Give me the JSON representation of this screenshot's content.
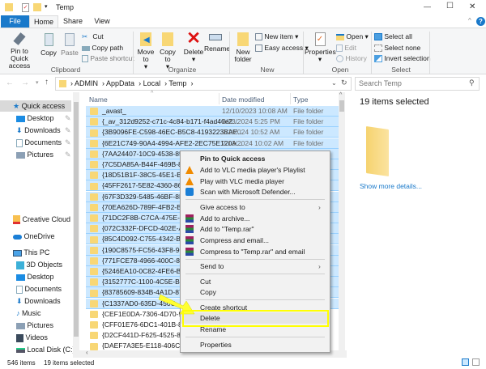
{
  "window": {
    "title": "Temp",
    "minimize": "—",
    "maximize": "☐",
    "close": "✕",
    "help": "?"
  },
  "tabs": [
    {
      "label": "File"
    },
    {
      "label": "Home"
    },
    {
      "label": "Share"
    },
    {
      "label": "View"
    }
  ],
  "ribbon": {
    "clipboard": {
      "group": "Clipboard",
      "pin": "Pin to Quick access",
      "copy": "Copy",
      "paste": "Paste",
      "cut": "Cut",
      "copy_path": "Copy path",
      "paste_shortcut": "Paste shortcut"
    },
    "organize": {
      "group": "Organize",
      "move_to": "Move to",
      "copy_to": "Copy to",
      "delete": "Delete",
      "rename": "Rename"
    },
    "new": {
      "group": "New",
      "new_folder": "New folder",
      "new_item": "New item",
      "easy_access": "Easy access"
    },
    "open": {
      "group": "Open",
      "properties": "Properties",
      "open": "Open",
      "edit": "Edit",
      "history": "History"
    },
    "select": {
      "group": "Select",
      "select_all": "Select all",
      "select_none": "Select none",
      "invert": "Invert selection"
    }
  },
  "address": {
    "crumbs": [
      "ADMIN",
      "AppData",
      "Local",
      "Temp"
    ],
    "search_placeholder": "Search Temp"
  },
  "nav": {
    "quick_access": "Quick access",
    "quick_items": [
      "Desktop",
      "Downloads",
      "Documents",
      "Pictures"
    ],
    "creative_cloud": "Creative Cloud Fil",
    "onedrive": "OneDrive",
    "this_pc": "This PC",
    "pc_items": [
      "3D Objects",
      "Desktop",
      "Documents",
      "Downloads",
      "Music",
      "Pictures",
      "Videos",
      "Local Disk (C:)"
    ]
  },
  "columns": {
    "name": "Name",
    "date": "Date modified",
    "type": "Type"
  },
  "files": [
    {
      "name": "_avast_",
      "date": "12/10/2023 10:08 AM",
      "type": "File folder",
      "selected": true
    },
    {
      "name": "{_av_312d9252-c71c-4c84-b171-f4ad46e2...",
      "date": "2/23/2024 5:25 PM",
      "type": "File folder",
      "selected": true
    },
    {
      "name": "{3B9096FE-C598-46EC-B5C8-4193223BAE...",
      "date": "2/1/2024 10:52 AM",
      "type": "File folder",
      "selected": true
    },
    {
      "name": "{6E21C749-90A4-4994-AFE2-2EC75E120A...",
      "date": "2/13/2024 10:02 AM",
      "type": "File folder",
      "selected": true
    },
    {
      "name": "{7AA24407-10C9-4538-8522-5",
      "selected": true
    },
    {
      "name": "{7C5DA85A-B44F-469B-84AD-",
      "selected": true
    },
    {
      "name": "{18D51B1F-38C5-45E1-BA4C-",
      "selected": true
    },
    {
      "name": "{45FF2617-5E82-4360-86E6-14",
      "selected": true
    },
    {
      "name": "{67F3D329-5485-46BF-8E94-61",
      "selected": true
    },
    {
      "name": "{70EA626D-789F-4FB2-B075-4",
      "selected": true
    },
    {
      "name": "{71DC2F8B-C7CA-475E-B237-",
      "selected": true
    },
    {
      "name": "{072C332F-DFCD-402E-AC65-",
      "selected": true
    },
    {
      "name": "{85C4D092-C755-4342-B417-E",
      "selected": true
    },
    {
      "name": "{190C8575-FC56-43F8-909F-2",
      "selected": true
    },
    {
      "name": "{771FCE78-4966-400C-81B8-D",
      "selected": true
    },
    {
      "name": "{5246EA10-0C82-4FE6-B65D-6",
      "selected": true
    },
    {
      "name": "{3152777C-1100-4C5E-BFAC-1",
      "selected": true
    },
    {
      "name": "{83785609-834B-4A1D-8710-D",
      "selected": true
    },
    {
      "name": "{C1337AD0-635D-450C-",
      "selected": true
    },
    {
      "name": "{CEF1E0DA-7306-4D70-9026-1",
      "selected": false
    },
    {
      "name": "{CFF01E76-6DC1-401B-811C-5",
      "selected": false
    },
    {
      "name": "{D2CF441D-F625-4525-845D-7",
      "selected": false
    },
    {
      "name": "{DAEF7A3E5-E118-406C-A5C7-",
      "selected": false
    }
  ],
  "details": {
    "title": "19 items selected",
    "show_more": "Show more details..."
  },
  "status": {
    "count": "546 items",
    "selected": "19 items selected"
  },
  "context_menu": {
    "items": [
      {
        "label": "Pin to Quick access",
        "icon": "none",
        "bold": true
      },
      {
        "label": "Add to VLC media player's Playlist",
        "icon": "vlc-icon"
      },
      {
        "label": "Play with VLC media player",
        "icon": "vlc-icon"
      },
      {
        "label": "Scan with Microsoft Defender...",
        "icon": "defender-icon"
      },
      {
        "label": "Give access to",
        "submenu": true
      },
      {
        "label": "Add to archive...",
        "icon": "winrar-icon"
      },
      {
        "label": "Add to \"Temp.rar\"",
        "icon": "winrar-icon"
      },
      {
        "label": "Compress and email...",
        "icon": "winrar-icon"
      },
      {
        "label": "Compress to \"Temp.rar\" and email",
        "icon": "winrar-icon"
      },
      {
        "label": "Send to",
        "submenu": true
      },
      {
        "label": "Cut"
      },
      {
        "label": "Copy"
      },
      {
        "label": "Create shortcut"
      },
      {
        "label": "Delete",
        "highlighted": true
      },
      {
        "label": "Rename"
      },
      {
        "label": "Properties"
      }
    ]
  },
  "colors": {
    "accent": "#1979ca",
    "selection": "#cce8ff",
    "highlight_box": "#ffff00",
    "folder": "#f8d775"
  }
}
